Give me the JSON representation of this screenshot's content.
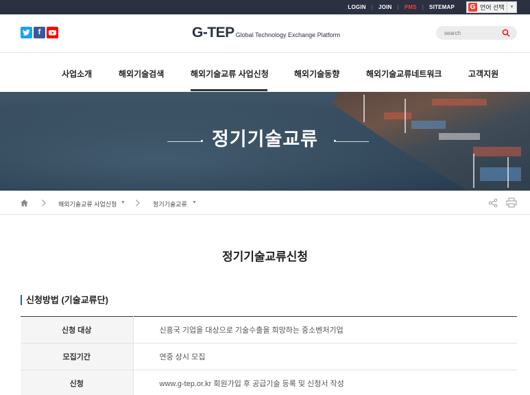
{
  "topbar": {
    "login": "LOGIN",
    "join": "JOIN",
    "pms": "PMS",
    "sitemap": "SITEMAP",
    "language_label": "언어 선택"
  },
  "header": {
    "social": [
      "twitter-icon",
      "facebook-icon",
      "youtube-icon"
    ],
    "logo_main": "G-TEP",
    "logo_sub": "Global Technology Exchange Platform",
    "search_placeholder": "search"
  },
  "nav": {
    "items": [
      "사업소개",
      "해외기술검색",
      "해외기술교류 사업신청",
      "해외기술동향",
      "해외기술교류네트워크",
      "고객지원"
    ],
    "active_index": 2
  },
  "banner": {
    "title": "정기기술교류"
  },
  "breadcrumb": {
    "level1": "해외기술교류 사업신청",
    "level2": "정기기술교류"
  },
  "content": {
    "page_title": "정기기술교류신청",
    "section_title": "신청방법 (기술교류단)",
    "rows": [
      {
        "label": "신청 대상",
        "value": "신흥국 기업을 대상으로 기술수출을 희망하는 중소벤처기업"
      },
      {
        "label": "모집기간",
        "value": "연중 상시 모집"
      },
      {
        "label": "신청",
        "value": "www.g-tep.or.kr 회원가입 후 공급기술 등록 및 신청서 작성"
      }
    ]
  },
  "colors": {
    "topbar_bg": "#2b3140",
    "accent_red": "#e60012",
    "pms_red": "#ff3b30",
    "section_bar_blue": "#1f5fb0"
  }
}
